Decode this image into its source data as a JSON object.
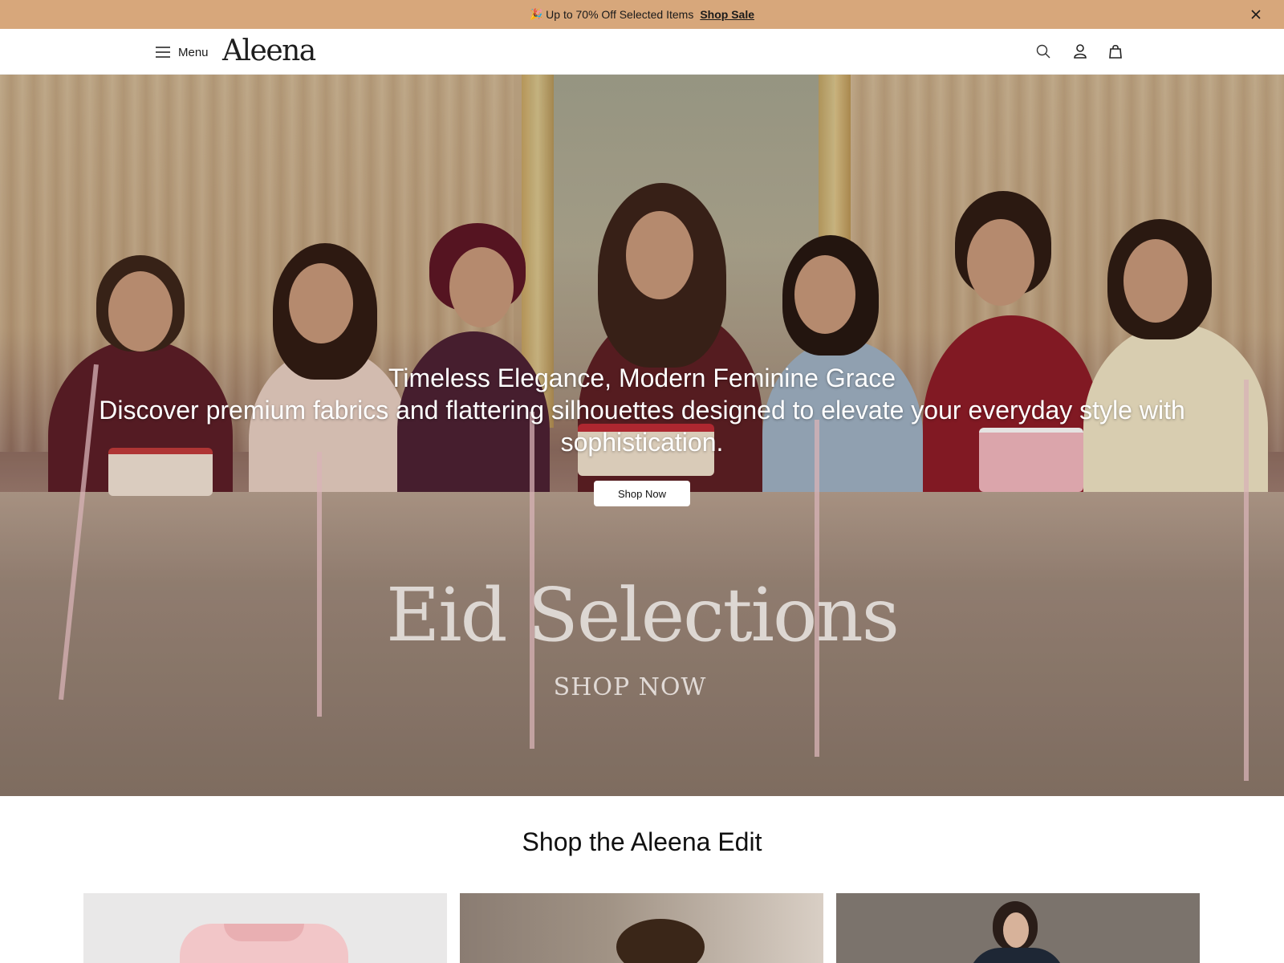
{
  "announcement": {
    "icon": "gift-icon",
    "text": "Up to 70% Off Selected Items",
    "link": "Shop Sale"
  },
  "header": {
    "menu_label": "Menu",
    "logo": "Aleena"
  },
  "hero": {
    "headline": "Timeless Elegance, Modern Feminine Grace",
    "subline": "Discover premium fabrics and flattering silhouettes designed to elevate your everyday style with sophistication.",
    "button_label": "Shop Now",
    "campaign_title": "Eid Selections",
    "campaign_cta": "SHOP NOW"
  },
  "section": {
    "title": "Shop the Aleena Edit"
  },
  "colors": {
    "announcement_bg": "#d7a77b",
    "text": "#1a1a1a",
    "button_bg": "#ffffff"
  }
}
